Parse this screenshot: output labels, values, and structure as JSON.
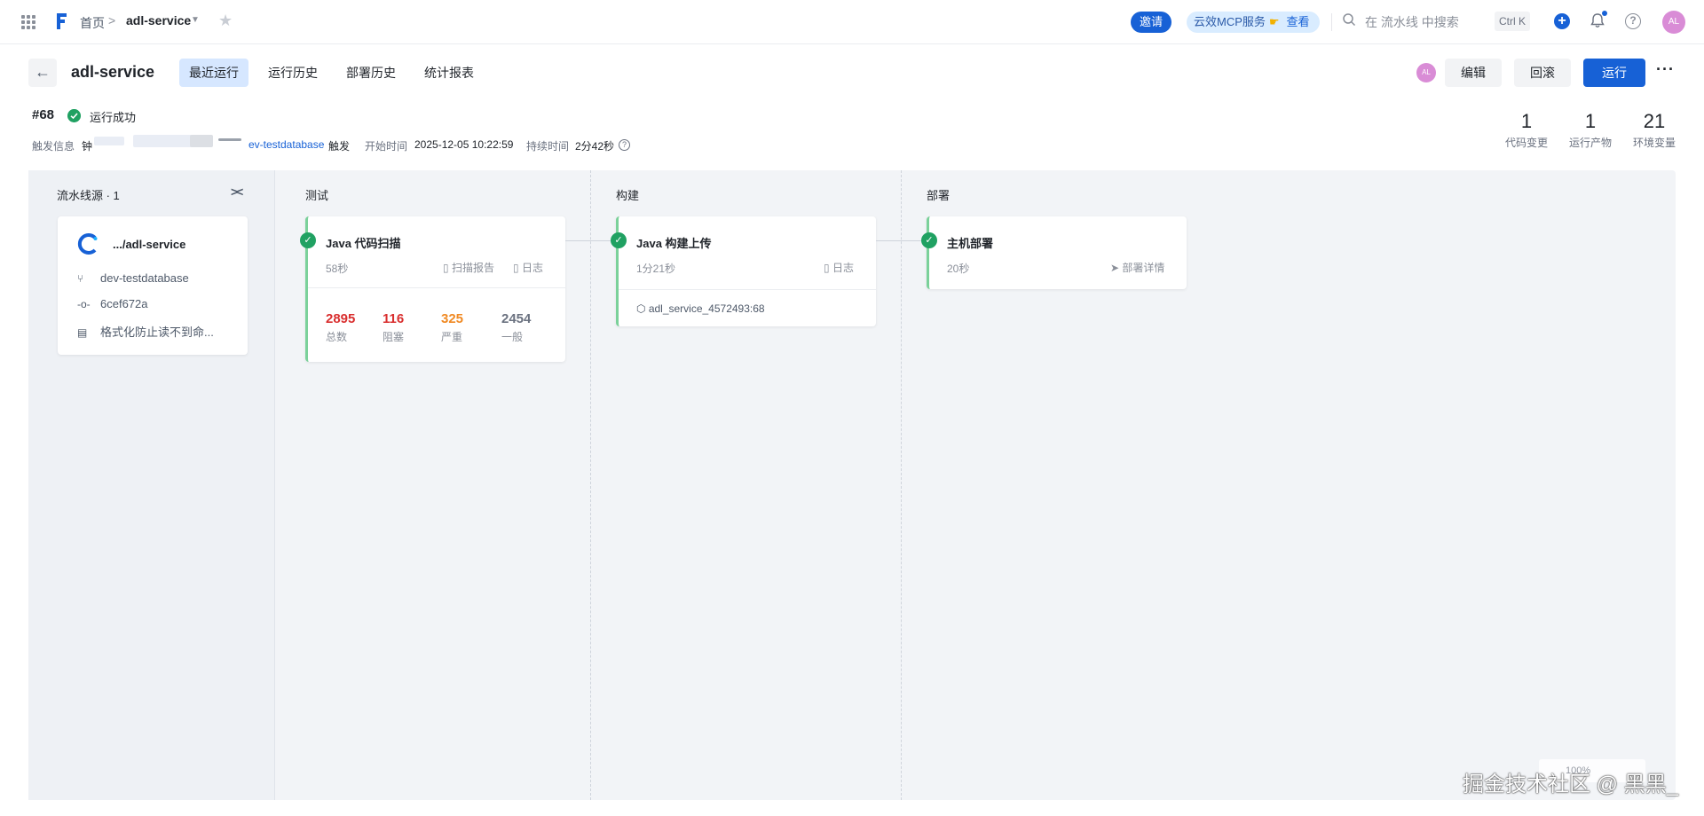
{
  "topbar": {
    "breadcrumb_home": "首页",
    "breadcrumb_sep": ">",
    "breadcrumb_project": "adl-service",
    "invite_label": "邀请",
    "mcp_label": "云效MCP服务",
    "mcp_view": "查看",
    "search_placeholder": "在 流水线 中搜索",
    "search_shortcut": "Ctrl K",
    "avatar_initials": "AL"
  },
  "header": {
    "title": "adl-service",
    "tabs": [
      {
        "label": "最近运行",
        "active": true
      },
      {
        "label": "运行历史",
        "active": false
      },
      {
        "label": "部署历史",
        "active": false
      },
      {
        "label": "统计报表",
        "active": false
      }
    ],
    "avatar_initials": "AL",
    "edit_label": "编辑",
    "rollback_label": "回滚",
    "run_label": "运行",
    "more_label": "···"
  },
  "run": {
    "number": "#68",
    "status": "运行成功",
    "trigger_label": "触发信息",
    "trigger_user": "钟",
    "trigger_branch": "ev-testdatabase",
    "trigger_action": "触发",
    "start_label": "开始时间",
    "start_time": "2025-12-05 10:22:59",
    "duration_label": "持续时间",
    "duration": "2分42秒",
    "stats": [
      {
        "value": "1",
        "label": "代码变更"
      },
      {
        "value": "1",
        "label": "运行产物"
      },
      {
        "value": "21",
        "label": "环境变量"
      }
    ]
  },
  "pipeline": {
    "source": {
      "title": "流水线源 · 1",
      "repo": ".../adl-service",
      "branch": "dev-testdatabase",
      "commit": "6cef672a",
      "message": "格式化防止读不到命..."
    },
    "stages": [
      {
        "title": "测试",
        "job": {
          "name": "Java 代码扫描",
          "duration": "58秒",
          "report_label": "扫描报告",
          "log_label": "日志",
          "metrics": [
            {
              "value": "2895",
              "label": "总数",
              "color": "#d92f2f"
            },
            {
              "value": "116",
              "label": "阻塞",
              "color": "#d92f2f"
            },
            {
              "value": "325",
              "label": "严重",
              "color": "#f08a24"
            },
            {
              "value": "2454",
              "label": "一般",
              "color": "#6b7280"
            }
          ]
        }
      },
      {
        "title": "构建",
        "job": {
          "name": "Java 构建上传",
          "duration": "1分21秒",
          "log_label": "日志",
          "artifact": "adl_service_4572493:68"
        }
      },
      {
        "title": "部署",
        "job": {
          "name": "主机部署",
          "duration": "20秒",
          "detail_label": "部署详情"
        }
      }
    ]
  },
  "canvas": {
    "zoom": "100%"
  },
  "watermark": "掘金技术社区 @ 黑黑_",
  "colors": {
    "primary": "#1761d6",
    "success": "#20a162",
    "active_tab": "#d6e7ff"
  },
  "icons": [
    "apps-icon",
    "logo-icon",
    "star-icon",
    "search-icon",
    "plus-icon",
    "bell-icon",
    "help-icon",
    "back-arrow-icon",
    "check-icon",
    "branch-icon",
    "commit-icon",
    "message-icon",
    "document-icon",
    "log-icon",
    "package-icon",
    "send-icon",
    "collapse-icon",
    "more-icon"
  ]
}
